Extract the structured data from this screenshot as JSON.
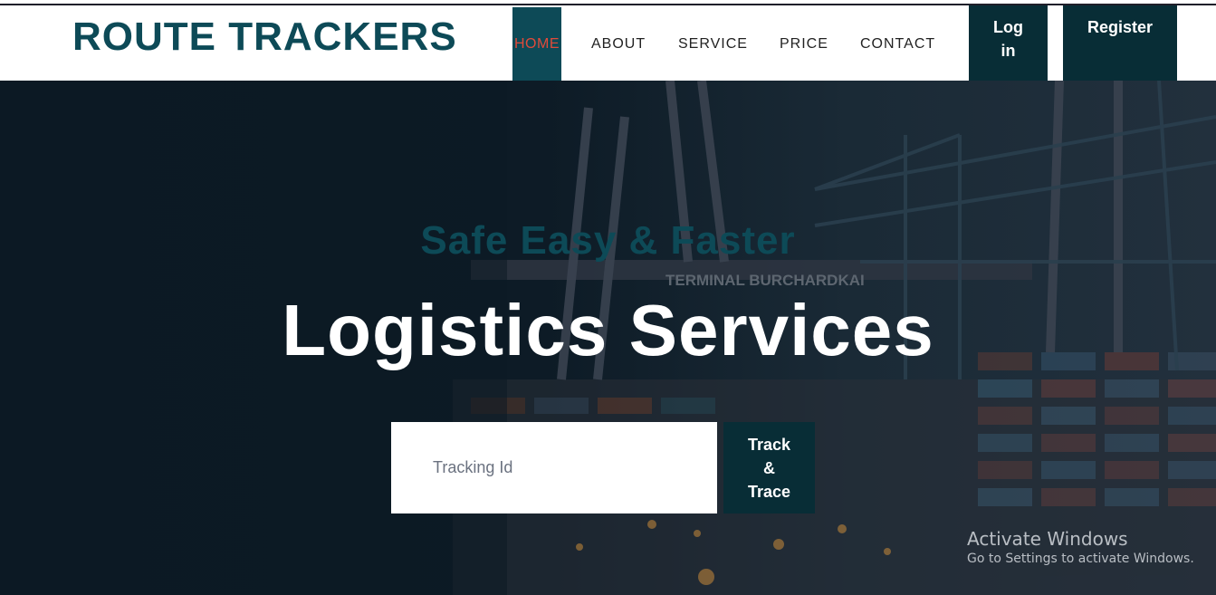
{
  "header": {
    "logo": "ROUTE TRACKERS",
    "nav": {
      "home": "HOME",
      "about": "ABOUT",
      "service": "SERVICE",
      "price": "PRICE",
      "contact": "CONTACT"
    },
    "login_line1": "Log",
    "login_line2": "in",
    "register": "Register"
  },
  "hero": {
    "tagline": "Safe Easy & Faster",
    "title": "Logistics Services",
    "background_sign": "TERMINAL BURCHARDKAI",
    "tracking_placeholder": "Tracking Id",
    "track_line1": "Track",
    "track_line2": "&",
    "track_line3": "Trace"
  },
  "os_watermark": {
    "title": "Activate Windows",
    "subtitle": "Go to Settings to activate Windows."
  },
  "colors": {
    "brand_teal": "#0d4a57",
    "button_dark": "#082d36",
    "active_nav_text": "#e04a3a"
  }
}
